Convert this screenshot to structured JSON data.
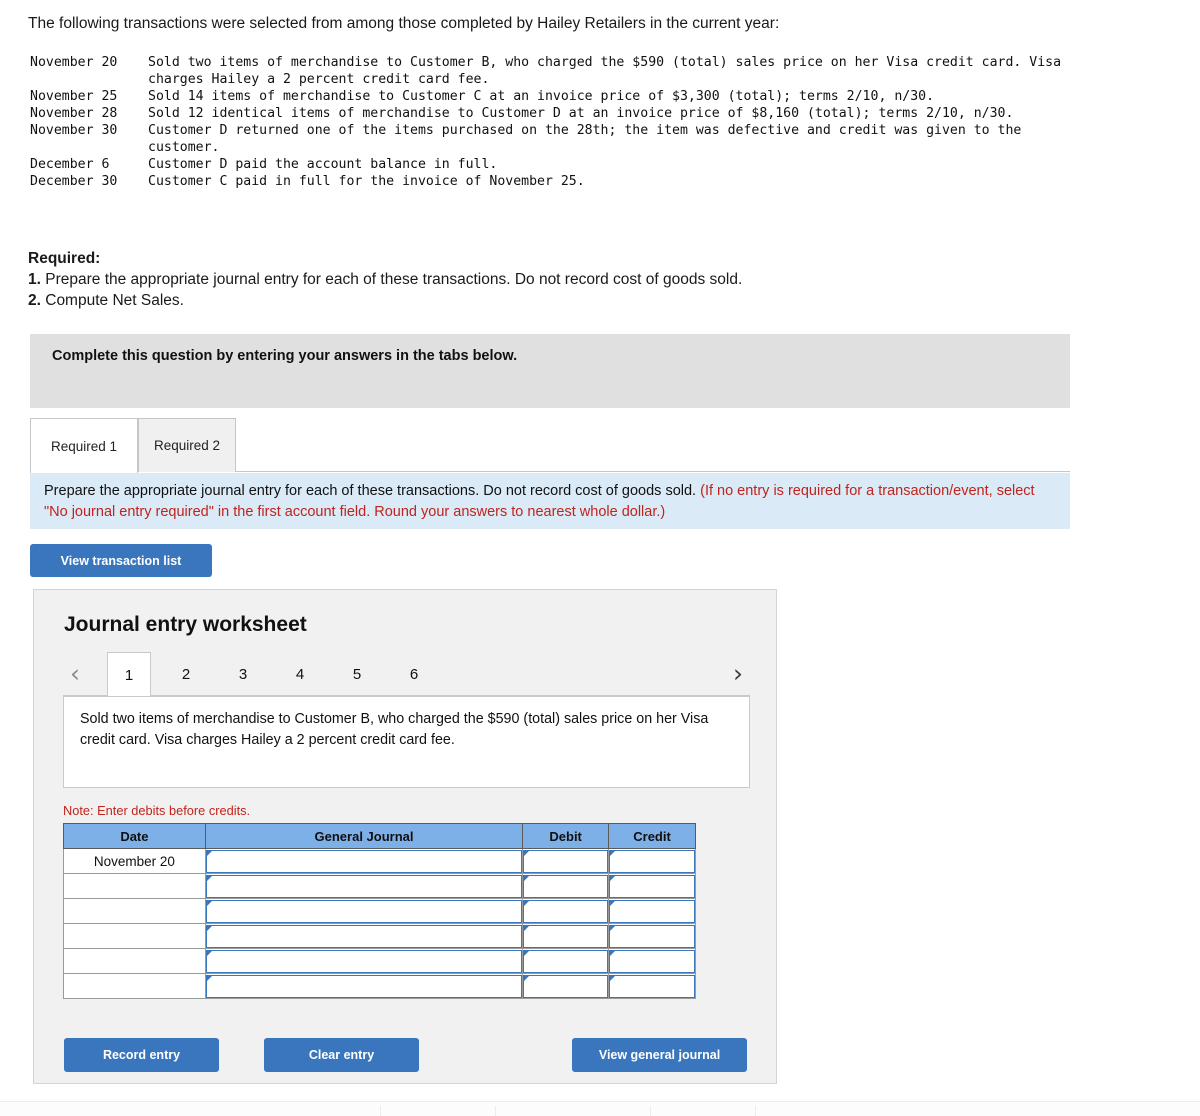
{
  "intro": "The following transactions were selected from among those completed by Hailey Retailers in the current year:",
  "transactions": [
    {
      "date": "November 20",
      "desc": "Sold two items of merchandise to Customer B, who charged the $590 (total) sales price on her Visa credit card. Visa charges Hailey a 2 percent credit card fee."
    },
    {
      "date": "November 25",
      "desc": "Sold 14 items of merchandise to Customer C at an invoice price of $3,300 (total); terms 2/10, n/30."
    },
    {
      "date": "November 28",
      "desc": "Sold 12 identical items of merchandise to Customer D at an invoice price of $8,160 (total); terms 2/10, n/30."
    },
    {
      "date": "November 30",
      "desc": "Customer D returned one of the items purchased on the 28th; the item was defective and credit was given to the customer."
    },
    {
      "date": "December 6",
      "desc": "Customer D paid the account balance in full."
    },
    {
      "date": "December 30",
      "desc": "Customer C paid in full for the invoice of November 25."
    }
  ],
  "required": {
    "heading": "Required:",
    "items": [
      {
        "num": "1.",
        "text": " Prepare the appropriate journal entry for each of these transactions. Do not record cost of goods sold."
      },
      {
        "num": "2.",
        "text": " Compute Net Sales."
      }
    ]
  },
  "callout": {
    "text": "Complete this question by entering your answers in the tabs below."
  },
  "tabs": [
    {
      "label": "Required 1",
      "active": true
    },
    {
      "label": "Required 2",
      "active": false
    }
  ],
  "instruction": {
    "black": "Prepare the appropriate journal entry for each of these transactions. Do not record cost of goods sold. ",
    "red": "(If no entry is required for a transaction/event, select \"No journal entry required\" in the first account field. Round your answers to nearest whole dollar.)"
  },
  "buttons": {
    "view_transaction_list": "View transaction list",
    "record_entry": "Record entry",
    "clear_entry": "Clear entry",
    "view_general_journal": "View general journal"
  },
  "worksheet": {
    "title": "Journal entry worksheet",
    "prev_icon": "chevron-left",
    "next_icon": "chevron-right",
    "pages": [
      "1",
      "2",
      "3",
      "4",
      "5",
      "6"
    ],
    "active_page": "1",
    "description": "Sold two items of merchandise to Customer B, who charged the $590 (total) sales price on her Visa credit card. Visa charges Hailey a 2 percent credit card fee.",
    "note": "Note: Enter debits before credits.",
    "table": {
      "headers": [
        "Date",
        "General Journal",
        "Debit",
        "Credit"
      ],
      "rows": [
        {
          "date": "November 20",
          "general_journal": "",
          "debit": "",
          "credit": ""
        },
        {
          "date": "",
          "general_journal": "",
          "debit": "",
          "credit": ""
        },
        {
          "date": "",
          "general_journal": "",
          "debit": "",
          "credit": ""
        },
        {
          "date": "",
          "general_journal": "",
          "debit": "",
          "credit": ""
        },
        {
          "date": "",
          "general_journal": "",
          "debit": "",
          "credit": ""
        },
        {
          "date": "",
          "general_journal": "",
          "debit": "",
          "credit": ""
        }
      ]
    }
  },
  "colors": {
    "primary_button": "#3a76bd",
    "table_header": "#7eb0e8",
    "info_bar": "#daeaf7",
    "callout_bg": "#e0e0e0",
    "panel_bg": "#f1f1f1",
    "red_text": "#c0241c"
  }
}
